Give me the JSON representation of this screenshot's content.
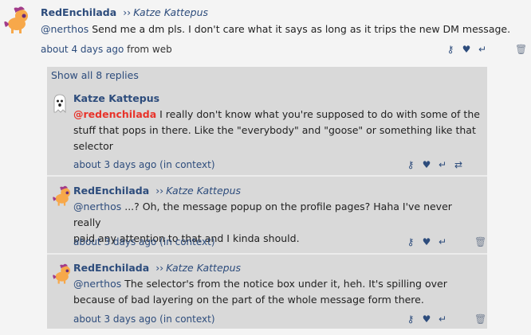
{
  "main_notice": {
    "author": "RedEnchilada",
    "arrows": "››",
    "recipient": "Katze Kattepus",
    "mention": "@nerthos",
    "text": " Send me a dm pls. I don't care what it says as long as it trips the new DM message.",
    "time": "about 4 days ago",
    "source": "from web"
  },
  "thread": {
    "show_all": "Show all 8 replies",
    "replies": [
      {
        "author": "Katze Kattepus",
        "mention": "@redenchilada",
        "lines": [
          " I really don't know what you're supposed to do with some of the",
          "stuff that pops in there. Like the \"everybody\" and \"goose\" or something like that",
          "selector"
        ],
        "time": "about 3 days ago",
        "context": "(in context)"
      },
      {
        "author": "RedEnchilada",
        "arrows": "››",
        "recipient": "Katze Kattepus",
        "mention": "@nerthos",
        "lines": [
          " ...? Oh, the message popup on the profile pages? Haha I've never really",
          "paid any attention to that and I kinda should."
        ],
        "time": "about 3 days ago",
        "context": "(in context)"
      },
      {
        "author": "RedEnchilada",
        "arrows": "››",
        "recipient": "Katze Kattepus",
        "mention": "@nerthos",
        "lines": [
          " The selector's from the notice box under it, heh. It's spilling over",
          "because of bad layering on the part of the whole message form there."
        ],
        "time": "about 3 days ago",
        "context": "(in context)"
      }
    ]
  },
  "icons": {
    "reply": "reply-icon",
    "favorite": "heart-icon",
    "share": "repeat-icon",
    "delete": "trash-icon",
    "key": "key-icon"
  },
  "colors": {
    "link": "#2d4c7c",
    "mention_self": "#e8332a",
    "thread_bg": "#d9d9d9",
    "page_bg": "#f4f4f4"
  }
}
